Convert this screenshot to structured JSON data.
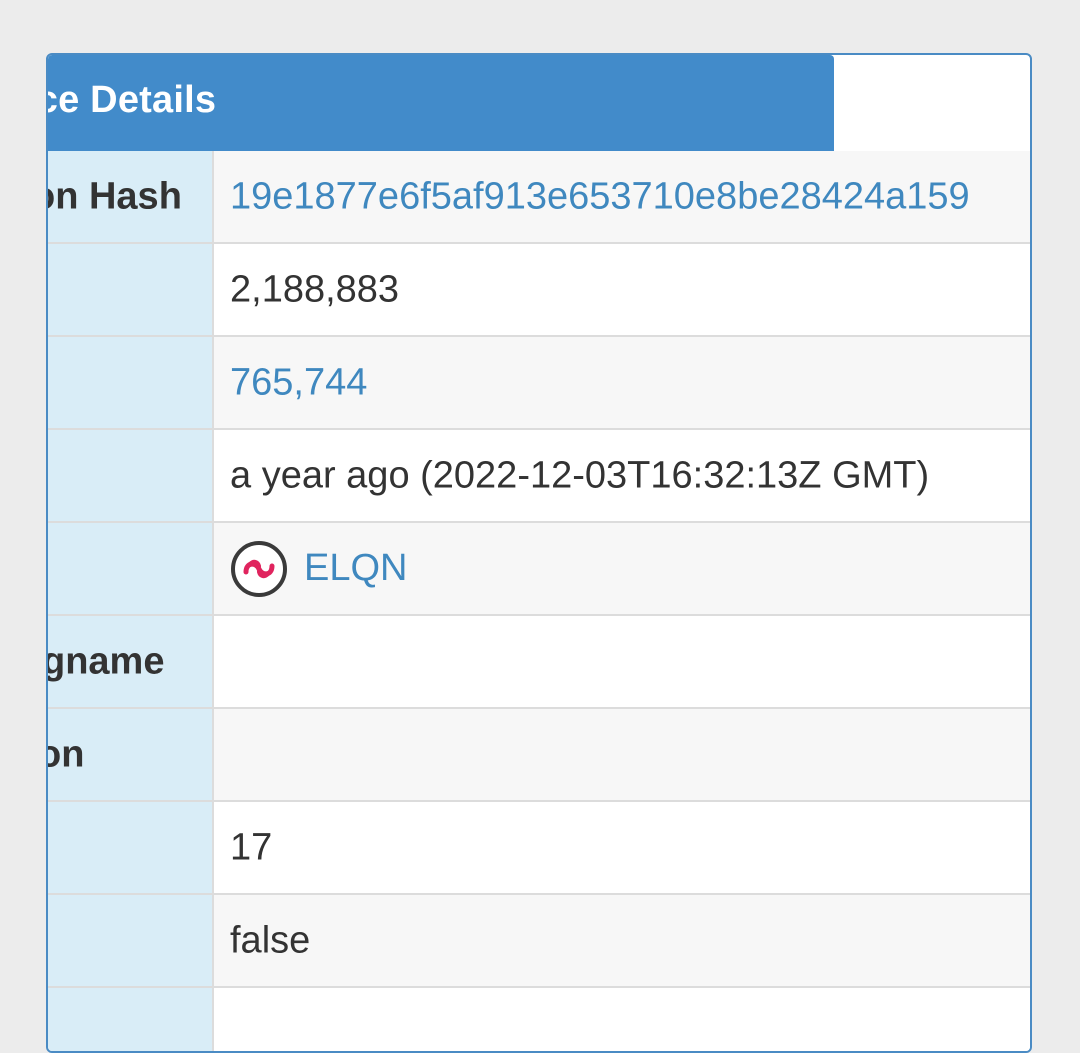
{
  "panel": {
    "title": "ance Details"
  },
  "rows": [
    {
      "label": "on Hash",
      "value": "19e1877e6f5af913e653710e8be28424a159",
      "link": true
    },
    {
      "label": "",
      "value": "2,188,883",
      "link": false
    },
    {
      "label": "",
      "value": "765,744",
      "link": true
    },
    {
      "label": "",
      "value": "a year ago (2022-12-03T16:32:13Z GMT)",
      "link": false
    },
    {
      "label": "",
      "token_name": "ELQN",
      "token_icon": "elqn-logo-icon"
    },
    {
      "label": "gname",
      "value": ""
    },
    {
      "label": "on",
      "value": ""
    },
    {
      "label": "",
      "value": "17",
      "link": false
    },
    {
      "label": "",
      "value": "false",
      "link": false
    },
    {
      "label": "",
      "value": ""
    }
  ],
  "colors": {
    "header_bg": "#428bca",
    "label_bg": "#d9edf7",
    "link": "#3f88bf",
    "token_logo": "#e0245e"
  }
}
